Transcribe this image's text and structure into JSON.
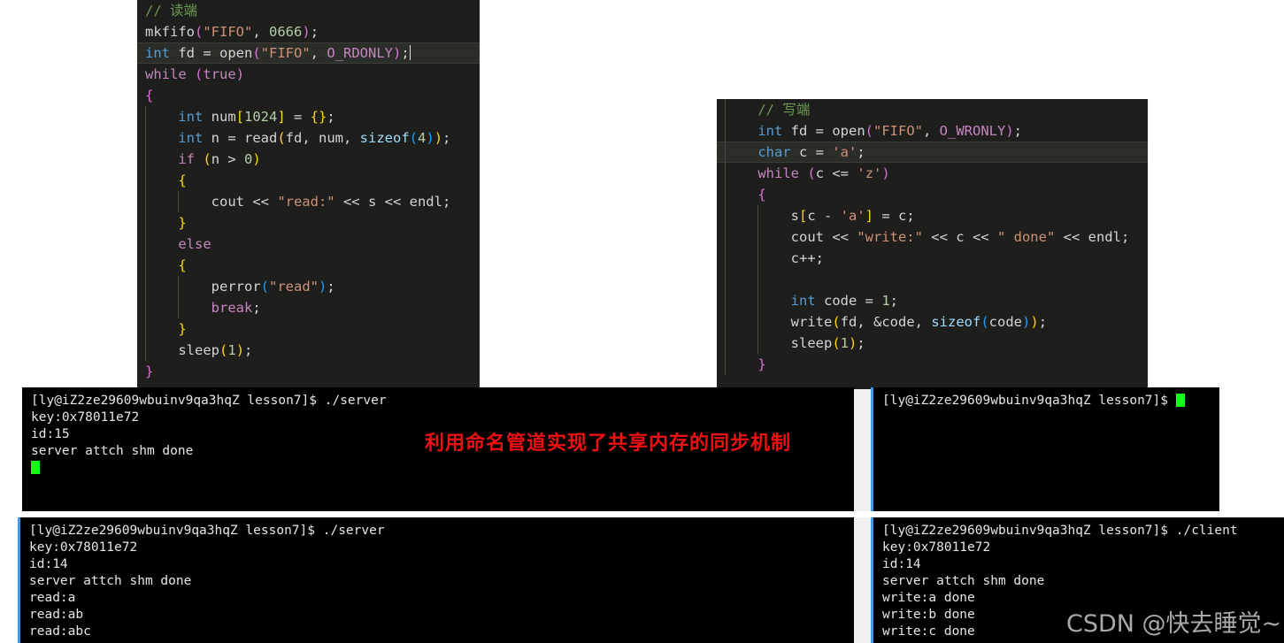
{
  "editor_reader": {
    "title": "reader-code-panel",
    "lines": [
      {
        "tokens": [
          {
            "t": "// 读端",
            "c": "t-com"
          }
        ]
      },
      {
        "tokens": [
          {
            "t": "mkfifo",
            "c": "t-plain"
          },
          {
            "t": "(",
            "c": "t-par1"
          },
          {
            "t": "\"FIFO\"",
            "c": "t-str"
          },
          {
            "t": ", ",
            "c": "t-plain"
          },
          {
            "t": "0666",
            "c": "t-num"
          },
          {
            "t": ")",
            "c": "t-par1"
          },
          {
            "t": ";",
            "c": "t-plain"
          }
        ]
      },
      {
        "active": true,
        "caret": true,
        "tokens": [
          {
            "t": "int",
            "c": "t-kw"
          },
          {
            "t": " fd = ",
            "c": "t-plain"
          },
          {
            "t": "open",
            "c": "t-plain"
          },
          {
            "t": "(",
            "c": "t-par1"
          },
          {
            "t": "\"FIFO\"",
            "c": "t-str"
          },
          {
            "t": ", ",
            "c": "t-plain"
          },
          {
            "t": "O_RDONLY",
            "c": "t-macro"
          },
          {
            "t": ")",
            "c": "t-par1"
          },
          {
            "t": ";",
            "c": "t-plain"
          }
        ]
      },
      {
        "tokens": [
          {
            "t": "while",
            "c": "t-ctl"
          },
          {
            "t": " ",
            "c": "t-plain"
          },
          {
            "t": "(",
            "c": "t-par1"
          },
          {
            "t": "true",
            "c": "t-ctl"
          },
          {
            "t": ")",
            "c": "t-par1"
          }
        ]
      },
      {
        "tokens": [
          {
            "t": "{",
            "c": "t-par1"
          }
        ]
      },
      {
        "guide": 1,
        "tokens": [
          {
            "t": "    ",
            "c": "t-plain"
          },
          {
            "t": "int",
            "c": "t-kw"
          },
          {
            "t": " num",
            "c": "t-plain"
          },
          {
            "t": "[",
            "c": "t-par2"
          },
          {
            "t": "1024",
            "c": "t-num"
          },
          {
            "t": "]",
            "c": "t-par2"
          },
          {
            "t": " = ",
            "c": "t-plain"
          },
          {
            "t": "{}",
            "c": "t-par2"
          },
          {
            "t": ";",
            "c": "t-plain"
          }
        ]
      },
      {
        "guide": 1,
        "tokens": [
          {
            "t": "    ",
            "c": "t-plain"
          },
          {
            "t": "int",
            "c": "t-kw"
          },
          {
            "t": " n = ",
            "c": "t-plain"
          },
          {
            "t": "read",
            "c": "t-plain"
          },
          {
            "t": "(",
            "c": "t-par2"
          },
          {
            "t": "fd, num, ",
            "c": "t-plain"
          },
          {
            "t": "sizeof",
            "c": "t-var"
          },
          {
            "t": "(",
            "c": "t-par3"
          },
          {
            "t": "4",
            "c": "t-num"
          },
          {
            "t": ")",
            "c": "t-par3"
          },
          {
            "t": ")",
            "c": "t-par2"
          },
          {
            "t": ";",
            "c": "t-plain"
          }
        ]
      },
      {
        "guide": 1,
        "tokens": [
          {
            "t": "    ",
            "c": "t-plain"
          },
          {
            "t": "if",
            "c": "t-ctl"
          },
          {
            "t": " ",
            "c": "t-plain"
          },
          {
            "t": "(",
            "c": "t-par2"
          },
          {
            "t": "n > ",
            "c": "t-plain"
          },
          {
            "t": "0",
            "c": "t-num"
          },
          {
            "t": ")",
            "c": "t-par2"
          }
        ]
      },
      {
        "guide": 1,
        "tokens": [
          {
            "t": "    ",
            "c": "t-plain"
          },
          {
            "t": "{",
            "c": "t-par2"
          }
        ]
      },
      {
        "guide": 2,
        "tokens": [
          {
            "t": "        ",
            "c": "t-plain"
          },
          {
            "t": "cout",
            "c": "t-plain"
          },
          {
            "t": " << ",
            "c": "t-plain"
          },
          {
            "t": "\"read:\"",
            "c": "t-str"
          },
          {
            "t": " << s << ",
            "c": "t-plain"
          },
          {
            "t": "endl",
            "c": "t-plain"
          },
          {
            "t": ";",
            "c": "t-plain"
          }
        ]
      },
      {
        "guide": 1,
        "tokens": [
          {
            "t": "    ",
            "c": "t-plain"
          },
          {
            "t": "}",
            "c": "t-par2"
          }
        ]
      },
      {
        "guide": 1,
        "tokens": [
          {
            "t": "    ",
            "c": "t-plain"
          },
          {
            "t": "else",
            "c": "t-ctl"
          }
        ]
      },
      {
        "guide": 1,
        "tokens": [
          {
            "t": "    ",
            "c": "t-plain"
          },
          {
            "t": "{",
            "c": "t-par2"
          }
        ]
      },
      {
        "guide": 2,
        "tokens": [
          {
            "t": "        ",
            "c": "t-plain"
          },
          {
            "t": "perror",
            "c": "t-plain"
          },
          {
            "t": "(",
            "c": "t-par3"
          },
          {
            "t": "\"read\"",
            "c": "t-str"
          },
          {
            "t": ")",
            "c": "t-par3"
          },
          {
            "t": ";",
            "c": "t-plain"
          }
        ]
      },
      {
        "guide": 2,
        "tokens": [
          {
            "t": "        ",
            "c": "t-plain"
          },
          {
            "t": "break",
            "c": "t-ctl"
          },
          {
            "t": ";",
            "c": "t-plain"
          }
        ]
      },
      {
        "guide": 1,
        "tokens": [
          {
            "t": "    ",
            "c": "t-plain"
          },
          {
            "t": "}",
            "c": "t-par2"
          }
        ]
      },
      {
        "guide": 1,
        "tokens": [
          {
            "t": "    ",
            "c": "t-plain"
          },
          {
            "t": "sleep",
            "c": "t-plain"
          },
          {
            "t": "(",
            "c": "t-par2"
          },
          {
            "t": "1",
            "c": "t-num"
          },
          {
            "t": ")",
            "c": "t-par2"
          },
          {
            "t": ";",
            "c": "t-plain"
          }
        ]
      },
      {
        "tokens": [
          {
            "t": "}",
            "c": "t-par1"
          }
        ]
      }
    ]
  },
  "editor_writer": {
    "title": "writer-code-panel",
    "lines": [
      {
        "guide": 1,
        "tokens": [
          {
            "t": "    ",
            "c": "t-plain"
          },
          {
            "t": "// 写端",
            "c": "t-com"
          }
        ]
      },
      {
        "guide": 1,
        "tokens": [
          {
            "t": "    ",
            "c": "t-plain"
          },
          {
            "t": "int",
            "c": "t-kw"
          },
          {
            "t": " fd = ",
            "c": "t-plain"
          },
          {
            "t": "open",
            "c": "t-plain"
          },
          {
            "t": "(",
            "c": "t-par1"
          },
          {
            "t": "\"FIFO\"",
            "c": "t-str"
          },
          {
            "t": ", ",
            "c": "t-plain"
          },
          {
            "t": "O_WRONLY",
            "c": "t-macro"
          },
          {
            "t": ")",
            "c": "t-par1"
          },
          {
            "t": ";",
            "c": "t-plain"
          }
        ]
      },
      {
        "active": true,
        "guide": 1,
        "tokens": [
          {
            "t": "    ",
            "c": "t-plain"
          },
          {
            "t": "char",
            "c": "t-kw"
          },
          {
            "t": " c = ",
            "c": "t-plain"
          },
          {
            "t": "'a'",
            "c": "t-str"
          },
          {
            "t": ";",
            "c": "t-plain"
          }
        ]
      },
      {
        "guide": 1,
        "tokens": [
          {
            "t": "    ",
            "c": "t-plain"
          },
          {
            "t": "while",
            "c": "t-ctl"
          },
          {
            "t": " ",
            "c": "t-plain"
          },
          {
            "t": "(",
            "c": "t-par1"
          },
          {
            "t": "c <= ",
            "c": "t-plain"
          },
          {
            "t": "'z'",
            "c": "t-str"
          },
          {
            "t": ")",
            "c": "t-par1"
          }
        ]
      },
      {
        "guide": 1,
        "tokens": [
          {
            "t": "    ",
            "c": "t-plain"
          },
          {
            "t": "{",
            "c": "t-par1"
          }
        ]
      },
      {
        "guide": 2,
        "tokens": [
          {
            "t": "        ",
            "c": "t-plain"
          },
          {
            "t": "s",
            "c": "t-plain"
          },
          {
            "t": "[",
            "c": "t-par2"
          },
          {
            "t": "c - ",
            "c": "t-plain"
          },
          {
            "t": "'a'",
            "c": "t-str"
          },
          {
            "t": "]",
            "c": "t-par2"
          },
          {
            "t": " = c;",
            "c": "t-plain"
          }
        ]
      },
      {
        "guide": 2,
        "tokens": [
          {
            "t": "        ",
            "c": "t-plain"
          },
          {
            "t": "cout",
            "c": "t-plain"
          },
          {
            "t": " << ",
            "c": "t-plain"
          },
          {
            "t": "\"write:\"",
            "c": "t-str"
          },
          {
            "t": " << c << ",
            "c": "t-plain"
          },
          {
            "t": "\" done\"",
            "c": "t-str"
          },
          {
            "t": " << ",
            "c": "t-plain"
          },
          {
            "t": "endl",
            "c": "t-plain"
          },
          {
            "t": ";",
            "c": "t-plain"
          }
        ]
      },
      {
        "guide": 2,
        "tokens": [
          {
            "t": "        ",
            "c": "t-plain"
          },
          {
            "t": "c++;",
            "c": "t-plain"
          }
        ]
      },
      {
        "guide": 2,
        "tokens": [
          {
            "t": "",
            "c": "t-plain"
          }
        ]
      },
      {
        "guide": 2,
        "tokens": [
          {
            "t": "        ",
            "c": "t-plain"
          },
          {
            "t": "int",
            "c": "t-kw"
          },
          {
            "t": " code = ",
            "c": "t-plain"
          },
          {
            "t": "1",
            "c": "t-num"
          },
          {
            "t": ";",
            "c": "t-plain"
          }
        ]
      },
      {
        "guide": 2,
        "tokens": [
          {
            "t": "        ",
            "c": "t-plain"
          },
          {
            "t": "write",
            "c": "t-plain"
          },
          {
            "t": "(",
            "c": "t-par2"
          },
          {
            "t": "fd, &code, ",
            "c": "t-plain"
          },
          {
            "t": "sizeof",
            "c": "t-var"
          },
          {
            "t": "(",
            "c": "t-par3"
          },
          {
            "t": "code",
            "c": "t-plain"
          },
          {
            "t": ")",
            "c": "t-par3"
          },
          {
            "t": ")",
            "c": "t-par2"
          },
          {
            "t": ";",
            "c": "t-plain"
          }
        ]
      },
      {
        "guide": 2,
        "tokens": [
          {
            "t": "        ",
            "c": "t-plain"
          },
          {
            "t": "sleep",
            "c": "t-plain"
          },
          {
            "t": "(",
            "c": "t-par2"
          },
          {
            "t": "1",
            "c": "t-num"
          },
          {
            "t": ")",
            "c": "t-par2"
          },
          {
            "t": ";",
            "c": "t-plain"
          }
        ]
      },
      {
        "guide": 1,
        "tokens": [
          {
            "t": "    ",
            "c": "t-plain"
          },
          {
            "t": "}",
            "c": "t-par1"
          }
        ]
      }
    ]
  },
  "terminal_top_left": {
    "name": "server-terminal-top-left",
    "lines": [
      "[ly@iZ2ze29609wbuinv9qa3hqZ lesson7]$ ./server",
      "key:0x78011e72",
      "id:15",
      "server attch shm done"
    ],
    "cursor": true
  },
  "terminal_top_right": {
    "name": "client-terminal-top-right",
    "lines": [
      "[ly@iZ2ze29609wbuinv9qa3hqZ lesson7]$ "
    ],
    "cursor": true
  },
  "terminal_bottom_left": {
    "name": "server-terminal-bottom-left",
    "lines": [
      "[ly@iZ2ze29609wbuinv9qa3hqZ lesson7]$ ./server",
      "key:0x78011e72",
      "id:14",
      "server attch shm done",
      "read:a",
      "read:ab",
      "read:abc"
    ],
    "cursor": false
  },
  "terminal_bottom_right": {
    "name": "client-terminal-bottom-right",
    "lines": [
      "[ly@iZ2ze29609wbuinv9qa3hqZ lesson7]$ ./client",
      "key:0x78011e72",
      "id:14",
      "server attch shm done",
      "write:a done",
      "write:b done",
      "write:c done"
    ],
    "cursor": false
  },
  "annotation": {
    "text": "利用命名管道实现了共享内存的同步机制",
    "color": "#ee1111"
  },
  "watermark": {
    "text": "CSDN @快去睡觉~"
  }
}
